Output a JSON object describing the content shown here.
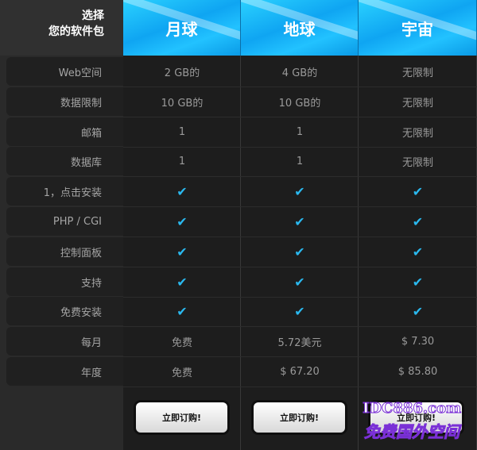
{
  "header": {
    "corner_line1": "选择",
    "corner_line2": "您的软件包",
    "plans": [
      "月球",
      "地球",
      "宇宙"
    ]
  },
  "rows": [
    {
      "label": "Web空间",
      "values": [
        "2 GB的",
        "4 GB的",
        "无限制"
      ]
    },
    {
      "label": "数据限制",
      "values": [
        "10 GB的",
        "10 GB的",
        "无限制"
      ]
    },
    {
      "label": "邮箱",
      "values": [
        "1",
        "1",
        "无限制"
      ]
    },
    {
      "label": "数据库",
      "values": [
        "1",
        "1",
        "无限制"
      ]
    },
    {
      "label": "1，点击安装",
      "values": [
        "✔",
        "✔",
        "✔"
      ]
    },
    {
      "label": "PHP / CGI",
      "values": [
        "✔",
        "✔",
        "✔"
      ]
    },
    {
      "label": "控制面板",
      "values": [
        "✔",
        "✔",
        "✔"
      ]
    },
    {
      "label": "支持",
      "values": [
        "✔",
        "✔",
        "✔"
      ]
    },
    {
      "label": "免费安装",
      "values": [
        "✔",
        "✔",
        "✔"
      ]
    },
    {
      "label": "每月",
      "values": [
        "免费",
        "5.72美元",
        "$ 7.30"
      ]
    },
    {
      "label": "年度",
      "values": [
        "免费",
        "$ 67.20",
        "$ 85.80"
      ]
    }
  ],
  "order_button_label": "立即订购!",
  "watermark": {
    "line1": "IDC886.com",
    "line2": "免费国外空间"
  },
  "colors": {
    "header_blue": "#1bb3f5",
    "check": "#2ab8ee",
    "background": "#2a2a2a"
  }
}
